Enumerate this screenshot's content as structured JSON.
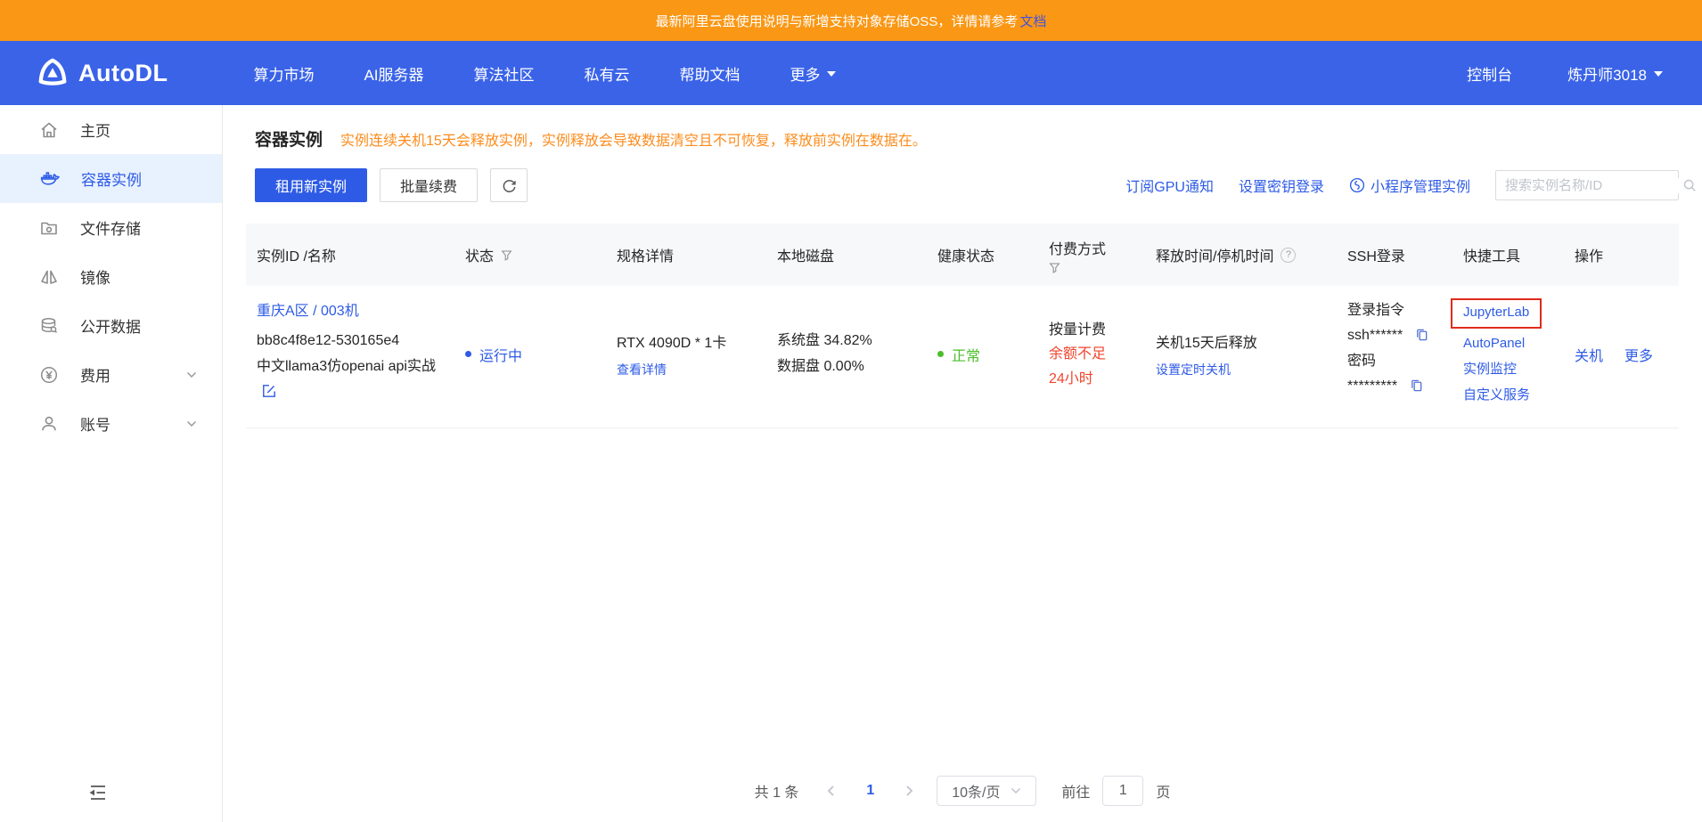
{
  "banner": {
    "text": "最新阿里云盘使用说明与新增支持对象存储OSS，详情请参考",
    "link_label": "文档"
  },
  "navbar": {
    "brand": "AutoDL",
    "items": [
      "算力市场",
      "AI服务器",
      "算法社区",
      "私有云",
      "帮助文档",
      "更多"
    ],
    "console": "控制台",
    "user": "炼丹师3018"
  },
  "sidebar": {
    "items": [
      "主页",
      "容器实例",
      "文件存储",
      "镜像",
      "公开数据",
      "费用",
      "账号"
    ]
  },
  "page": {
    "title": "容器实例",
    "notice": "实例连续关机15天会释放实例，实例释放会导致数据清空且不可恢复，释放前实例在数据在。"
  },
  "toolbar": {
    "rent_button": "租用新实例",
    "renew_button": "批量续费",
    "links": [
      "订阅GPU通知",
      "设置密钥登录",
      "小程序管理实例"
    ],
    "search_placeholder": "搜索实例名称/ID"
  },
  "table": {
    "headers": [
      "实例ID /名称",
      "状态",
      "规格详情",
      "本地磁盘",
      "健康状态",
      "付费方式",
      "释放时间/停机时间",
      "SSH登录",
      "快捷工具",
      "操作"
    ],
    "row": {
      "region": "重庆A区 / 003机",
      "instance_id": "bb8c4f8e12-530165e4",
      "instance_name": "中文llama3仿openai api实战",
      "status": "运行中",
      "gpu": "RTX 4090D * 1卡",
      "spec_link": "查看详情",
      "disk_system": "系统盘 34.82%",
      "disk_data": "数据盘 0.00%",
      "health": "正常",
      "billing": "按量计费",
      "billing_warning": "余额不足24小时",
      "release": "关机15天后释放",
      "release_link": "设置定时关机",
      "ssh_label": "登录指令",
      "ssh_value": "ssh******",
      "password_label": "密码",
      "password_value": "*********",
      "tools": [
        "JupyterLab",
        "AutoPanel",
        "实例监控",
        "自定义服务"
      ],
      "actions": [
        "关机",
        "更多"
      ]
    }
  },
  "pagination": {
    "total": "共 1 条",
    "page": "1",
    "page_size": "10条/页",
    "goto_label": "前往",
    "goto_value": "1",
    "unit": "页"
  },
  "colors": {
    "accent": "#2E5BE6",
    "navbar_bg": "#3A63E8",
    "banner_bg": "#FA9714",
    "notice_orange": "#FC8C1C",
    "danger_red": "#F2442D",
    "success_green": "#4CBE2A"
  }
}
